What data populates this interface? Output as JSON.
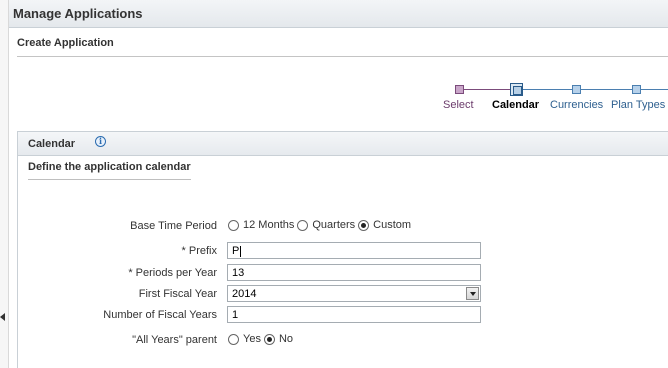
{
  "header": {
    "title": "Manage Applications"
  },
  "subheader": {
    "title": "Create Application"
  },
  "train": {
    "steps": [
      {
        "label": "Select",
        "state": "visited"
      },
      {
        "label": "Calendar",
        "state": "current"
      },
      {
        "label": "Currencies",
        "state": "future"
      },
      {
        "label": "Plan Types",
        "state": "future"
      }
    ]
  },
  "calendar": {
    "panel_title": "Calendar",
    "info_icon": "info-icon",
    "section_title": "Define the application calendar",
    "base_time_period": {
      "label": "Base Time Period",
      "options": [
        "12 Months",
        "Quarters",
        "Custom"
      ],
      "selected": "Custom"
    },
    "prefix": {
      "label": "* Prefix",
      "value": "P"
    },
    "periods_per_year": {
      "label": "* Periods per Year",
      "value": "13"
    },
    "first_fiscal_year": {
      "label": "First Fiscal Year",
      "value": "2014"
    },
    "number_of_fiscal_years": {
      "label": "Number of Fiscal Years",
      "value": "1"
    },
    "all_years_parent": {
      "label": "\"All Years\" parent",
      "options": [
        "Yes",
        "No"
      ],
      "selected": "No"
    }
  },
  "colors": {
    "visited": "#7b4b7b",
    "current": "#2a5b8a",
    "future": "#4b7fb0",
    "header_bg": "#e4e8ec"
  }
}
